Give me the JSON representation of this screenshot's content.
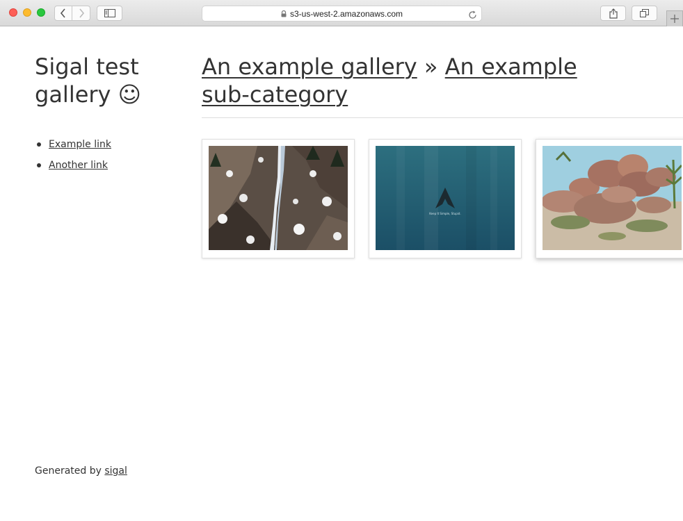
{
  "browser": {
    "url": "s3-us-west-2.amazonaws.com",
    "icons": [
      "back-icon",
      "forward-icon",
      "sidebar-icon",
      "lock-icon",
      "reload-icon",
      "share-icon",
      "tabs-icon",
      "new-tab-icon"
    ]
  },
  "site": {
    "title": "Sigal test gallery ☺",
    "links": [
      {
        "label": "Example link"
      },
      {
        "label": "Another link"
      }
    ]
  },
  "breadcrumb": {
    "parent": "An example gallery",
    "separator": " » ",
    "current": "An example sub-category"
  },
  "gallery": {
    "thumbnails": [
      {
        "subject": "waterfall-snow-cliff"
      },
      {
        "subject": "arch-linux-wallpaper",
        "caption": "Keep It Simple, Stupid."
      },
      {
        "subject": "desert-rocks"
      }
    ]
  },
  "footer": {
    "prefix": "Generated by ",
    "link": "sigal"
  }
}
